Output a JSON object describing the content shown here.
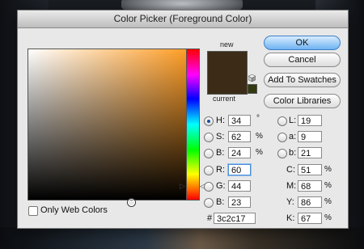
{
  "window": {
    "title": "Color Picker (Foreground Color)"
  },
  "swatch": {
    "new_label": "new",
    "current_label": "current",
    "color": "#3c2c17"
  },
  "buttons": {
    "ok": "OK",
    "cancel": "Cancel",
    "add_swatches": "Add To Swatches",
    "color_libraries": "Color Libraries"
  },
  "hsb": {
    "h": {
      "label": "H:",
      "value": "34",
      "unit": "°"
    },
    "s": {
      "label": "S:",
      "value": "62",
      "unit": "%"
    },
    "b": {
      "label": "B:",
      "value": "24",
      "unit": "%"
    }
  },
  "rgb": {
    "r": {
      "label": "R:",
      "value": "60"
    },
    "g": {
      "label": "G:",
      "value": "44"
    },
    "b": {
      "label": "B:",
      "value": "23"
    }
  },
  "lab": {
    "l": {
      "label": "L:",
      "value": "19"
    },
    "a": {
      "label": "a:",
      "value": "9"
    },
    "b": {
      "label": "b:",
      "value": "21"
    }
  },
  "cmyk": {
    "c": {
      "label": "C:",
      "value": "51",
      "unit": "%"
    },
    "m": {
      "label": "M:",
      "value": "68",
      "unit": "%"
    },
    "y": {
      "label": "Y:",
      "value": "86",
      "unit": "%"
    },
    "k": {
      "label": "K:",
      "value": "67",
      "unit": "%"
    }
  },
  "hex": {
    "label": "#",
    "value": "3c2c17"
  },
  "web_colors": {
    "label": "Only Web Colors",
    "checked": false
  },
  "selected_mode": "H"
}
